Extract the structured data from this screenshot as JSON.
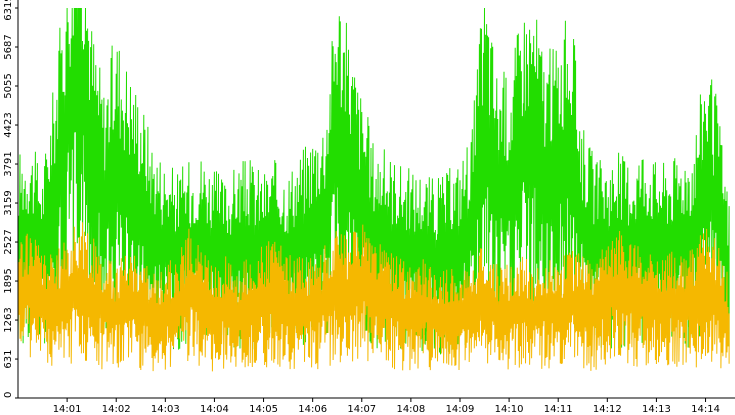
{
  "chart_data": {
    "type": "line",
    "title": "",
    "xlabel": "",
    "ylabel": "",
    "ylim": [
      0,
      6319
    ],
    "y_ticks": [
      "0",
      "631",
      "1263",
      "1895",
      "2527",
      "3159",
      "3791",
      "4423",
      "5055",
      "5687",
      "6319"
    ],
    "x_ticks": [
      "14:01",
      "14:02",
      "14:03",
      "14:04",
      "14:05",
      "14:06",
      "14:07",
      "14:08",
      "14:09",
      "14:10",
      "14:11",
      "14:12",
      "14:13",
      "14:14"
    ],
    "x_range_minutes": [
      0.0,
      14.6
    ],
    "grid": false,
    "legend": "none",
    "colors": {
      "series_green": "#22dd00",
      "series_orange": "#f5b800",
      "axis": "#000000",
      "background": "#ffffff"
    },
    "series": [
      {
        "color": "#22dd00",
        "x": [
          0.0,
          0.25,
          0.5,
          0.75,
          1.0,
          1.25,
          1.5,
          1.75,
          2.0,
          2.25,
          2.5,
          2.75,
          3.0,
          3.25,
          3.5,
          3.75,
          4.0,
          4.25,
          4.5,
          4.75,
          5.0,
          5.25,
          5.5,
          5.75,
          6.0,
          6.25,
          6.5,
          6.75,
          7.0,
          7.25,
          7.5,
          7.75,
          8.0,
          8.25,
          8.5,
          8.75,
          9.0,
          9.25,
          9.5,
          9.75,
          10.0,
          10.25,
          10.5,
          10.75,
          11.0,
          11.25,
          11.5,
          11.75,
          12.0,
          12.25,
          12.5,
          12.75,
          13.0,
          13.25,
          13.5,
          13.75,
          14.0,
          14.25,
          14.5
        ],
        "y": [
          2600,
          2700,
          2400,
          3400,
          4600,
          5600,
          4000,
          3300,
          3900,
          3500,
          3200,
          2700,
          2500,
          2400,
          2500,
          2600,
          2400,
          2300,
          2500,
          2500,
          2400,
          2500,
          2400,
          2600,
          2800,
          3000,
          4400,
          3800,
          3200,
          2700,
          2600,
          2500,
          2400,
          2400,
          2300,
          2400,
          2500,
          2900,
          4400,
          3500,
          3400,
          4100,
          4200,
          3600,
          3800,
          4100,
          2900,
          2500,
          2500,
          2600,
          2500,
          2700,
          2500,
          2500,
          2600,
          2700,
          3600,
          3100,
          2000
        ]
      },
      {
        "color": "#f5b800",
        "x": [
          0.0,
          0.25,
          0.5,
          0.75,
          1.0,
          1.25,
          1.5,
          1.75,
          2.0,
          2.25,
          2.5,
          2.75,
          3.0,
          3.25,
          3.5,
          3.75,
          4.0,
          4.25,
          4.5,
          4.75,
          5.0,
          5.25,
          5.5,
          5.75,
          6.0,
          6.25,
          6.5,
          6.75,
          7.0,
          7.25,
          7.5,
          7.75,
          8.0,
          8.25,
          8.5,
          8.75,
          9.0,
          9.25,
          9.5,
          9.75,
          10.0,
          10.25,
          10.5,
          10.75,
          11.0,
          11.25,
          11.5,
          11.75,
          12.0,
          12.25,
          12.5,
          12.75,
          13.0,
          13.25,
          13.5,
          13.75,
          14.0,
          14.25,
          14.5
        ],
        "y": [
          1700,
          1800,
          1600,
          1500,
          1700,
          1900,
          1700,
          1500,
          1400,
          1600,
          1500,
          1300,
          1400,
          1500,
          1800,
          1600,
          1400,
          1500,
          1400,
          1500,
          1600,
          1700,
          1500,
          1500,
          1500,
          1600,
          1800,
          1700,
          1900,
          1700,
          1600,
          1500,
          1400,
          1500,
          1300,
          1400,
          1300,
          1500,
          1600,
          1400,
          1400,
          1500,
          1400,
          1500,
          1400,
          1600,
          1500,
          1400,
          1700,
          1800,
          1700,
          1600,
          1500,
          1600,
          1500,
          1600,
          1800,
          1700,
          1200
        ]
      }
    ]
  }
}
